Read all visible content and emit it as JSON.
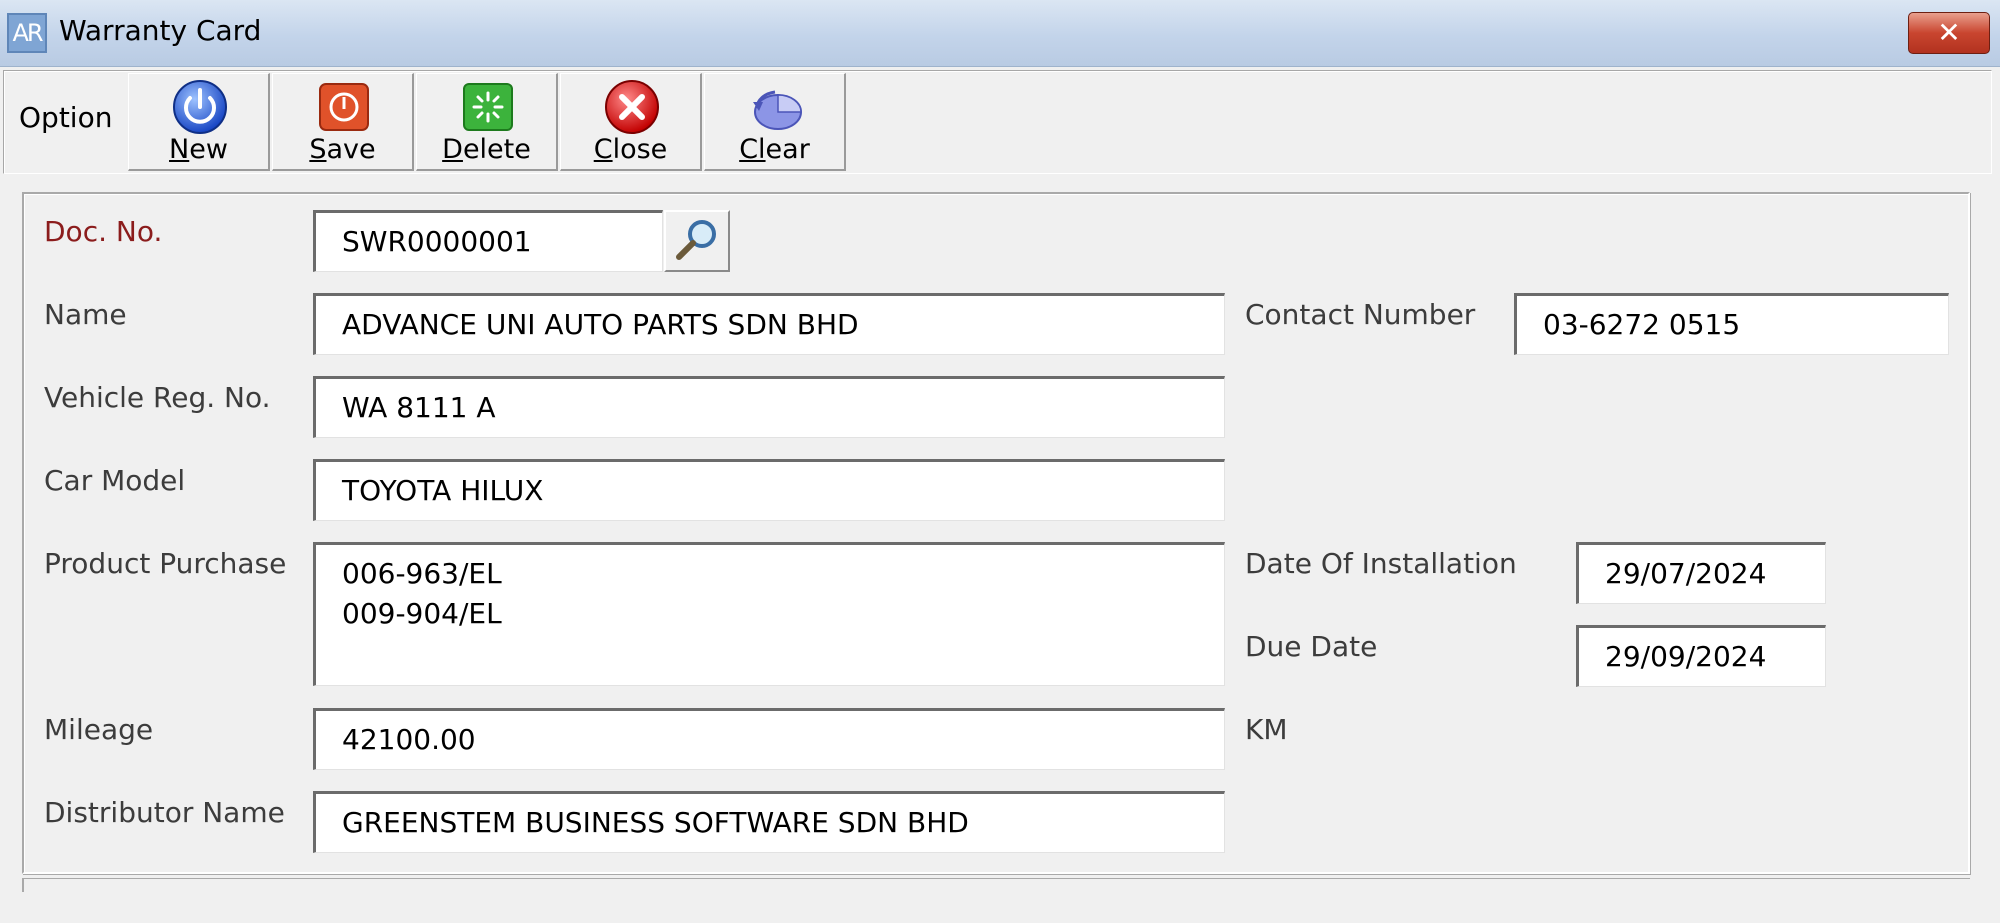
{
  "window": {
    "app_icon_text": "AR",
    "title": "Warranty Card",
    "close_glyph": "✕"
  },
  "toolbar": {
    "option_label": "Option",
    "buttons": [
      {
        "key": "N",
        "rest": "ew",
        "icon": "power-icon"
      },
      {
        "key": "S",
        "rest": "ave",
        "icon": "save-icon"
      },
      {
        "key": "D",
        "rest": "elete",
        "icon": "delete-icon"
      },
      {
        "key": "C",
        "rest": "lose",
        "icon": "close-icon"
      },
      {
        "key": "Cl",
        "rest": "ear",
        "icon": "clear-icon"
      }
    ]
  },
  "form": {
    "doc_no": {
      "label": "Doc. No.",
      "value": "SWR0000001"
    },
    "name": {
      "label": "Name",
      "value": "ADVANCE UNI AUTO PARTS SDN BHD"
    },
    "contact_number": {
      "label": "Contact Number",
      "value": "03-6272 0515"
    },
    "vehicle_reg_no": {
      "label": "Vehicle Reg. No.",
      "value": "WA 8111 A"
    },
    "car_model": {
      "label": "Car Model",
      "value": "TOYOTA HILUX"
    },
    "product_purchase": {
      "label": "Product Purchase",
      "value": "006-963/EL\n009-904/EL"
    },
    "date_of_installation": {
      "label": "Date Of Installation",
      "value": "29/07/2024"
    },
    "due_date": {
      "label": "Due Date",
      "value": "29/09/2024"
    },
    "mileage": {
      "label": "Mileage",
      "value": "42100.00",
      "unit": "KM"
    },
    "distributor_name": {
      "label": "Distributor Name",
      "value": "GREENSTEM BUSINESS SOFTWARE SDN BHD"
    }
  },
  "colors": {
    "title_bar": "#c3d4ea",
    "close_button": "#c9452f",
    "doc_no_label": "#8b1c1c",
    "background": "#f0f0f0"
  }
}
